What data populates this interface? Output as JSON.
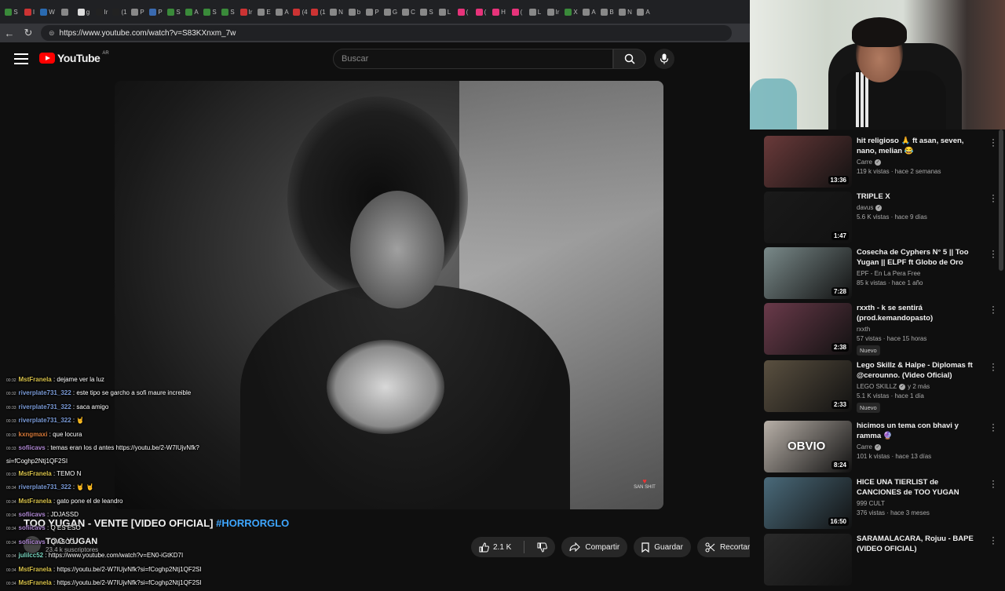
{
  "browser": {
    "tabs": [
      "S",
      "I",
      "W",
      "",
      "g",
      "Ir",
      "(1",
      "P",
      "P",
      "S",
      "A",
      "S",
      "S",
      "Ir",
      "E",
      "A",
      "(4",
      "(1",
      "N",
      "b",
      "P",
      "G",
      "C",
      "S",
      "L",
      "(",
      "(",
      "H",
      "(",
      "L",
      "Ir",
      "X",
      "A",
      "B",
      "N",
      "A"
    ],
    "back_icon": "arrow-left-icon",
    "reload_icon": "reload-icon",
    "url": "https://www.youtube.com/watch?v=S83KXnxm_7w"
  },
  "header": {
    "logo_text": "YouTube",
    "country": "AR",
    "search_placeholder": "Buscar"
  },
  "video": {
    "title_main": "TOO YUGAN - VENTE [VIDEO OFICIAL]",
    "title_hashtag": "#HORRORGLO",
    "channel": "TOO YUGAN",
    "subscribers": "23.4 k suscriptores",
    "watermark": "SAN SHIT",
    "likes": "2.1 K",
    "share": "Compartir",
    "save": "Guardar",
    "clip": "Recortar"
  },
  "chat": [
    {
      "time": "00:32",
      "user": "MstFranela",
      "color": "#d6c04a",
      "text": ": dejame ver la luz"
    },
    {
      "time": "00:32",
      "user": "riverplate731_322",
      "color": "#7a9ad6",
      "text": ": este tipo se garcho a sofi maure increible"
    },
    {
      "time": "00:33",
      "user": "riverplate731_322",
      "color": "#7a9ad6",
      "text": ": saca amigo"
    },
    {
      "time": "00:33",
      "user": "riverplate731_322",
      "color": "#7a9ad6",
      "text": ": 🤘"
    },
    {
      "time": "00:33",
      "user": "kxngmaxi",
      "color": "#d67a3a",
      "text": ": que locura"
    },
    {
      "time": "00:33",
      "user": "sofiicavs",
      "color": "#b28ad6",
      "text": ": temas eran los d antes https://youtu.be/2-W7IUjvNfk?si=fCoghp2Ntj1QF2SI"
    },
    {
      "time": "00:33",
      "user": "MstFranela",
      "color": "#d6c04a",
      "text": ": TEMO N"
    },
    {
      "time": "00:34",
      "user": "riverplate731_322",
      "color": "#7a9ad6",
      "text": ": 🤘 🤘"
    },
    {
      "time": "00:34",
      "user": "MstFranela",
      "color": "#d6c04a",
      "text": ": gato pone el de leandro"
    },
    {
      "time": "00:34",
      "user": "sofiicavs",
      "color": "#b28ad6",
      "text": ": JDJASSD"
    },
    {
      "time": "00:34",
      "user": "sofiicavs",
      "color": "#b28ad6",
      "text": ": Q ES ESO"
    },
    {
      "time": "00:34",
      "user": "sofiicavs",
      "color": "#b28ad6",
      "text": ": Q ASCO"
    },
    {
      "time": "00:34",
      "user": "julilcc52",
      "color": "#7ad6c0",
      "text": ": https://www.youtube.com/watch?v=EN0-iGtKD7I"
    },
    {
      "time": "00:34",
      "user": "MstFranela",
      "color": "#d6c04a",
      "text": ": https://youtu.be/2-W7IUjvNfk?si=fCoghp2Ntj1QF2SI"
    },
    {
      "time": "00:34",
      "user": "MstFranela",
      "color": "#d6c04a",
      "text": ": https://youtu.be/2-W7IUjvNfk?si=fCoghp2Ntj1QF2SI"
    }
  ],
  "recommendations": [
    {
      "title": "hit religioso 🙏 ft asan, seven, nano, melian 😂",
      "channel": "Carre",
      "verified": true,
      "meta": "119 k vistas · hace 2 semanas",
      "duration": "13:36",
      "badge": "",
      "thumb": "#6a3a3a"
    },
    {
      "title": "TRIPLE X",
      "channel": "davus",
      "verified": true,
      "meta": "5.6 K vistas · hace 9 días",
      "duration": "1:47",
      "badge": "",
      "thumb": "#1a1a1a"
    },
    {
      "title": "Cosecha de Cyphers N° 5 || Too Yugan || ELPF ft Globo de Oro",
      "channel": "EPF - En La Pera Free",
      "verified": false,
      "meta": "85 k vistas · hace 1 año",
      "duration": "7:28",
      "badge": "",
      "thumb": "#7a8a8a"
    },
    {
      "title": "rxxth - k se sentirá (prod.kemandopasto)",
      "channel": "rxxth",
      "verified": false,
      "meta": "57 vistas · hace 15 horas",
      "duration": "2:38",
      "badge": "Nuevo",
      "thumb": "#6a3a4a"
    },
    {
      "title": "Lego Skillz & Halpe - Diplomas ft @cerounno. (Video Oficial)",
      "channel": "LEGO SKILLZ",
      "verified": true,
      "meta": "5.1 K vistas · hace 1 día",
      "duration": "2:33",
      "badge": "Nuevo",
      "thumb": "#5a5040",
      "channel_extra": "y 2 más"
    },
    {
      "title": "hicimos un tema con bhavi y ramma 🔮",
      "channel": "Carre",
      "verified": true,
      "meta": "101 k vistas · hace 13 días",
      "duration": "8:24",
      "badge": "",
      "thumb": "#b8b0a8",
      "overlay": "OBVIO"
    },
    {
      "title": "HICE UNA TIERLIST de CANCIONES de TOO YUGAN",
      "channel": "999 CULT",
      "verified": false,
      "meta": "376 vistas · hace 3 meses",
      "duration": "16:50",
      "badge": "",
      "thumb": "#4a6a7a"
    },
    {
      "title": "SARAMALACARA, Rojuu - BAPE (VIDEO OFICIAL)",
      "channel": "",
      "verified": false,
      "meta": "",
      "duration": "",
      "badge": "",
      "thumb": "#2a2a2a"
    }
  ]
}
